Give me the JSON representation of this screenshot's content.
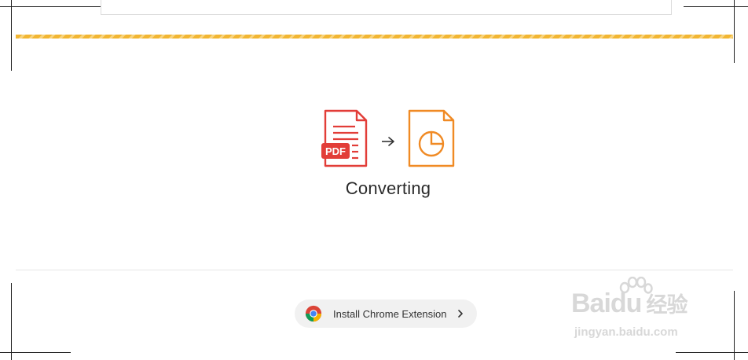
{
  "status": {
    "converting_text": "Converting",
    "source_format_label": "PDF"
  },
  "extension": {
    "button_label": "Install Chrome Extension"
  },
  "watermark": {
    "logo_text": "Baidu",
    "logo_cn": "经验",
    "url": "jingyan.baidu.com"
  },
  "colors": {
    "pdf_red": "#e23d38",
    "ppt_orange": "#f08a24",
    "progress_yellow": "#f2b632"
  }
}
